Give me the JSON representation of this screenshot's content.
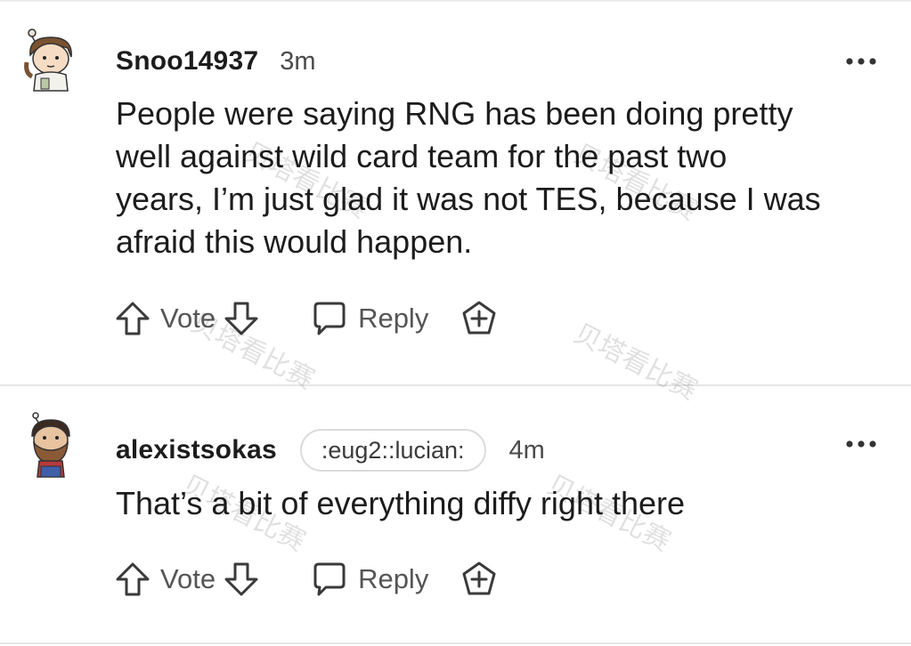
{
  "comments": [
    {
      "username": "Snoo14937",
      "flair": "",
      "time": "3m",
      "body": "People were saying RNG has been doing pretty\nwell against wild card team for the past two\nyears, I’m just glad it was not TES, because I was\nafraid this would happen.",
      "actions": {
        "vote": "Vote",
        "reply": "Reply"
      }
    },
    {
      "username": "alexistsokas",
      "flair": ":eug2::lucian:",
      "time": "4m",
      "body": "That’s a bit of everything diffy right there",
      "actions": {
        "vote": "Vote",
        "reply": "Reply"
      }
    }
  ],
  "icons": {
    "upvote": "arrow-up-icon",
    "downvote": "arrow-down-icon",
    "reply": "speech-bubble-icon",
    "award": "award-plus-icon",
    "more": "ellipsis-icon"
  },
  "watermark": "贝塔看比赛",
  "colors": {
    "text": "#1c1c1c",
    "muted": "#555555",
    "divider": "#e6e6e6"
  }
}
